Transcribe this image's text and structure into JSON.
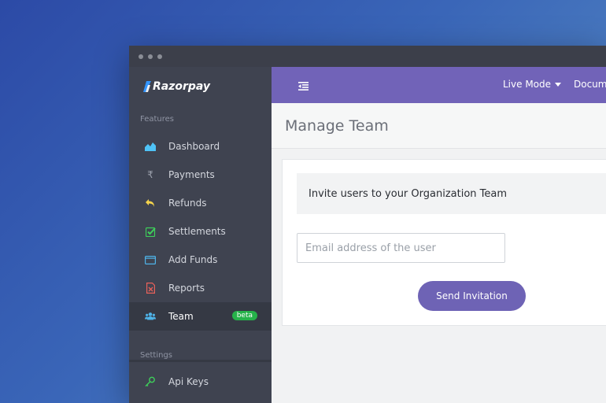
{
  "brand": {
    "name": "Razorpay",
    "color": "#ffffff"
  },
  "colors": {
    "topbar": "#7163b8",
    "button": "#6e63b5",
    "sidebar": "#3f4350",
    "badge": "#26b24a"
  },
  "sidebar": {
    "features_label": "Features",
    "settings_label": "Settings",
    "items": [
      {
        "label": "Dashboard",
        "icon": "area-chart-icon"
      },
      {
        "label": "Payments",
        "icon": "rupee-icon"
      },
      {
        "label": "Refunds",
        "icon": "undo-arrow-icon"
      },
      {
        "label": "Settlements",
        "icon": "checkbox-icon"
      },
      {
        "label": "Add Funds",
        "icon": "wallet-icon"
      },
      {
        "label": "Reports",
        "icon": "excel-file-icon"
      },
      {
        "label": "Team",
        "icon": "users-icon",
        "badge": "beta",
        "active": true
      }
    ],
    "settings_items": [
      {
        "label": "Api Keys",
        "icon": "key-icon"
      }
    ]
  },
  "topbar": {
    "mode_label": "Live Mode",
    "docs_label": "Docume"
  },
  "page": {
    "title": "Manage Team",
    "card_header": "Invite users to your Organization Team",
    "email_placeholder": "Email address of the user",
    "send_button": "Send Invitation"
  }
}
